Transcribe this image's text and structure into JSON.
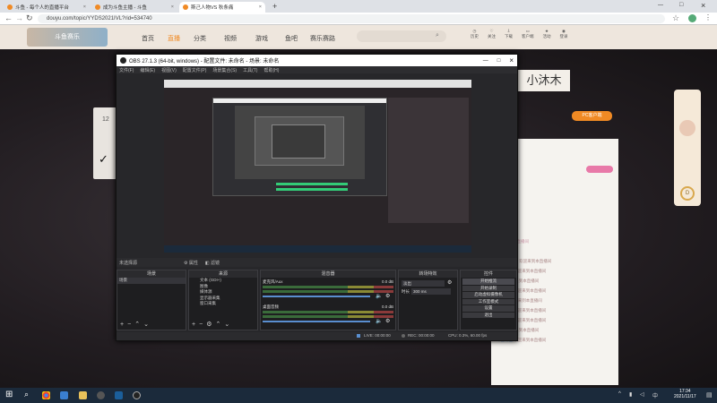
{
  "browser": {
    "tabs": [
      {
        "title": "斗鱼 - 每个人的直播平台",
        "close": "×"
      },
      {
        "title": "成为斗鱼主播 - 斗鱼",
        "close": "×"
      },
      {
        "title": "斯己人物VS 秋条痛",
        "close": "×"
      }
    ],
    "new_tab": "+",
    "url": "douyu.com/topic/YYDS2021IVL?rid=534740"
  },
  "site": {
    "nav": [
      "首页",
      "直播",
      "分类",
      "视频",
      "游戏",
      "鱼吧",
      "赛乐赛路"
    ],
    "user_icons": [
      "历史",
      "关注",
      "下载",
      "客户端",
      "活动",
      "登录"
    ],
    "banner_label": "斗鱼赛乐",
    "streamer_name": "小沐木",
    "pc_btn": "PC客户端",
    "follow_count": "12",
    "comments": [
      {
        "user": "欢迎来到本直播间",
        "text": "欢迎来到本直播间"
      },
      {
        "user": "Vlm",
        "text": "欢迎 了"
      },
      {
        "user": "NightHunter",
        "text": "欢迎来到本直播间"
      },
      {
        "user": "斗鱼粉丝",
        "text": "欢迎来到本直播间"
      },
      {
        "user": "NiCe",
        "text": "欢迎来到本直播间"
      },
      {
        "user": "斗鱼粉丝",
        "text": "欢迎来到本直播间"
      },
      {
        "user": "路过的",
        "text": "欢迎来到本直播间"
      },
      {
        "user": "斗鱼粉丝",
        "text": "欢迎来到本直播间"
      },
      {
        "user": "斗鱼粉丝",
        "text": "欢迎来到本直播间"
      },
      {
        "user": "NiCe",
        "text": "欢迎来到本直播间"
      },
      {
        "user": "斗鱼粉丝",
        "text": "欢迎来到本直播间"
      }
    ]
  },
  "obs": {
    "title": "OBS 27.1.3 (64-bit, windows) - 配置文件: 未命名 - 场景: 未命名",
    "controls": {
      "minimize": "—",
      "maximize": "□",
      "close": "×"
    },
    "menu": [
      "文件(F)",
      "编辑(E)",
      "视图(V)",
      "配置文件(P)",
      "场景集合(S)",
      "工具(T)",
      "帮助(H)"
    ],
    "source_toolbar": {
      "label": "未选择源",
      "props": "属性",
      "filters": "滤镜"
    },
    "docks": {
      "scenes": {
        "title": "场景",
        "items": [
          "场景"
        ]
      },
      "sources": {
        "title": "来源",
        "items": [
          "文本 (GDI+)",
          "图像",
          "媒体源",
          "显示器采集",
          "窗口采集"
        ]
      },
      "mixer": {
        "title": "混音器",
        "channels": [
          {
            "name": "麦克风/Aux",
            "db": "0.0 dB"
          },
          {
            "name": "桌面音频",
            "db": "0.0 dB"
          }
        ]
      },
      "transitions": {
        "title": "转场特效",
        "type": "淡出",
        "duration_label": "时长",
        "duration": "300 ms"
      },
      "controls": {
        "title": "控件",
        "buttons": [
          "开始推流",
          "开始录制",
          "启动虚拟摄像机",
          "工作室模式",
          "设置",
          "退出"
        ]
      }
    },
    "status": {
      "live": "LIVE: 00:00:00",
      "rec": "REC: 00:00:00",
      "cpu": "CPU: 0.3%, 60.00 fps"
    }
  },
  "taskbar": {
    "time": "17:34",
    "date": "2021/11/17",
    "lang": "中",
    "tray": "^"
  },
  "colors": {
    "accent_orange": "#f08a24",
    "obs_bg": "#27272a",
    "taskbar": "#1b2a3b",
    "site_header": "#eee6dd"
  }
}
